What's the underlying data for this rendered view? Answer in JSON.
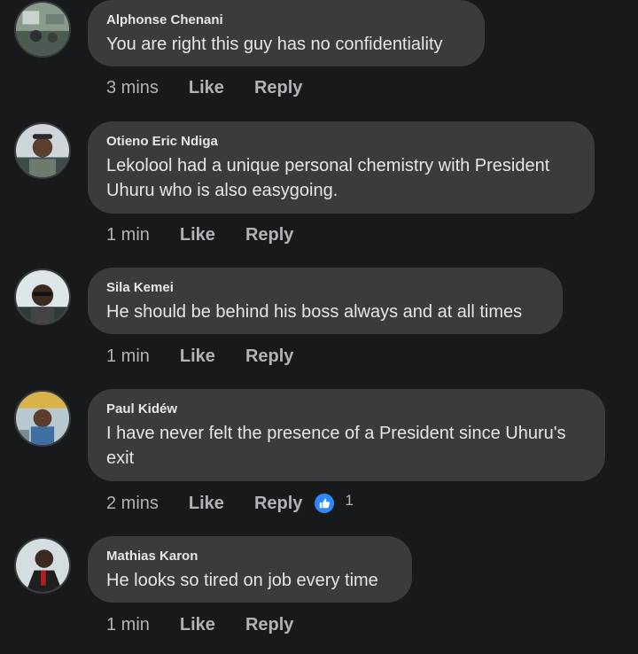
{
  "comments": [
    {
      "author": "Alphonse Chenani",
      "text": "You are right this guy has no confidentiality",
      "time": "3 mins",
      "like": "Like",
      "reply": "Reply"
    },
    {
      "author": "Otieno Eric Ndiga",
      "text": "Lekolool had a unique personal chemistry with President Uhuru who is also easygoing.",
      "time": "1 min",
      "like": "Like",
      "reply": "Reply"
    },
    {
      "author": "Sila Kemei",
      "text": "He should be behind his boss always and at all times",
      "time": "1 min",
      "like": "Like",
      "reply": "Reply"
    },
    {
      "author": "Paul Kidéw",
      "text": "I have never felt the presence of a President since Uhuru's exit",
      "time": "2 mins",
      "like": "Like",
      "reply": "Reply",
      "reaction": {
        "icon": "thumbs-up-icon",
        "count": "1"
      }
    },
    {
      "author": "Mathias Karon",
      "text": "He looks so tired on job every time",
      "time": "1 min",
      "like": "Like",
      "reply": "Reply"
    }
  ],
  "colors": {
    "background": "#18191a",
    "bubble": "#3a3b3c",
    "text": "#e4e6eb",
    "secondary": "#b0b3b8",
    "like_blue": "#2d88ff"
  }
}
